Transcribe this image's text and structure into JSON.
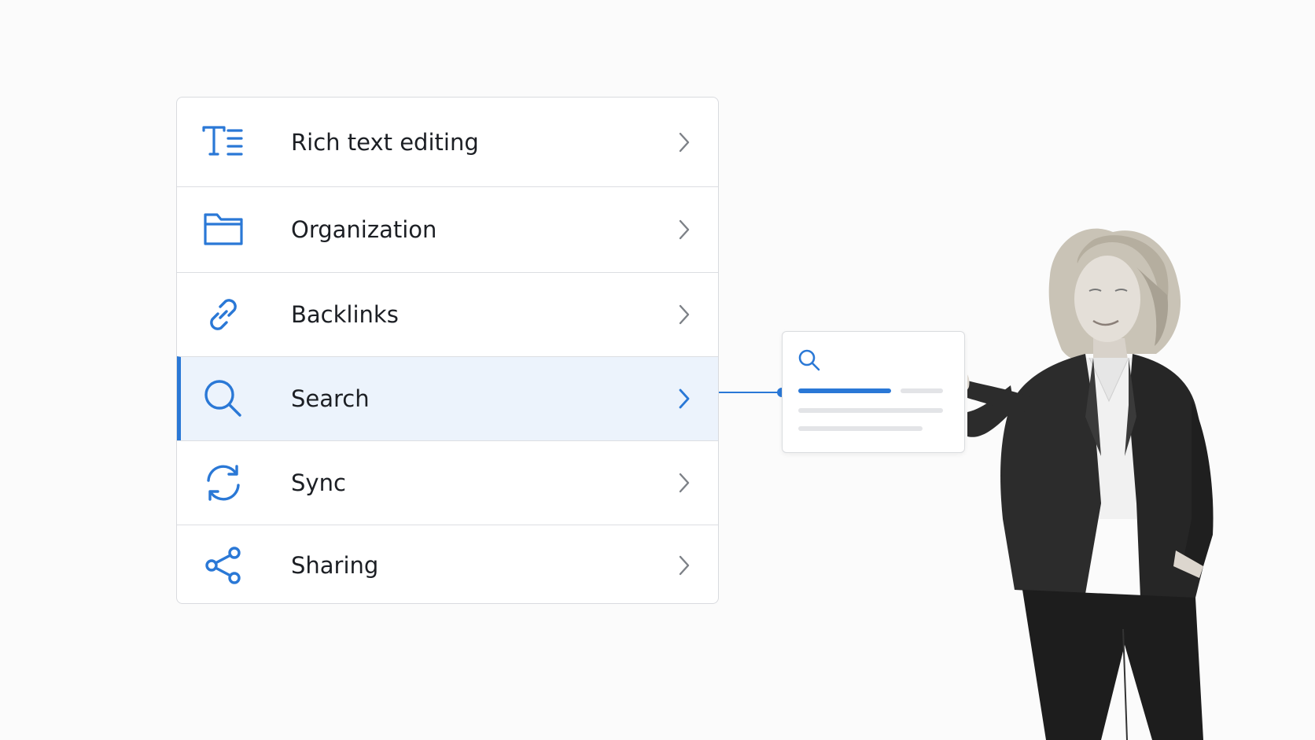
{
  "feature_menu": {
    "selected_index": 3,
    "items": [
      {
        "label": "Rich text editing",
        "icon": "rich-text-icon"
      },
      {
        "label": "Organization",
        "icon": "folder-icon"
      },
      {
        "label": "Backlinks",
        "icon": "link-icon"
      },
      {
        "label": "Search",
        "icon": "search-icon"
      },
      {
        "label": "Sync",
        "icon": "sync-icon"
      },
      {
        "label": "Sharing",
        "icon": "share-icon"
      }
    ]
  },
  "search_preview": {
    "icon": "search-icon"
  },
  "presenter": {
    "description_icon": "presenter-pointing-illustration"
  },
  "colors": {
    "accent": "#2a78d6",
    "selected_background": "#ecf3fc",
    "text": "#1c1f24",
    "divider": "#dcdee2",
    "chevron": "#7d8187"
  }
}
